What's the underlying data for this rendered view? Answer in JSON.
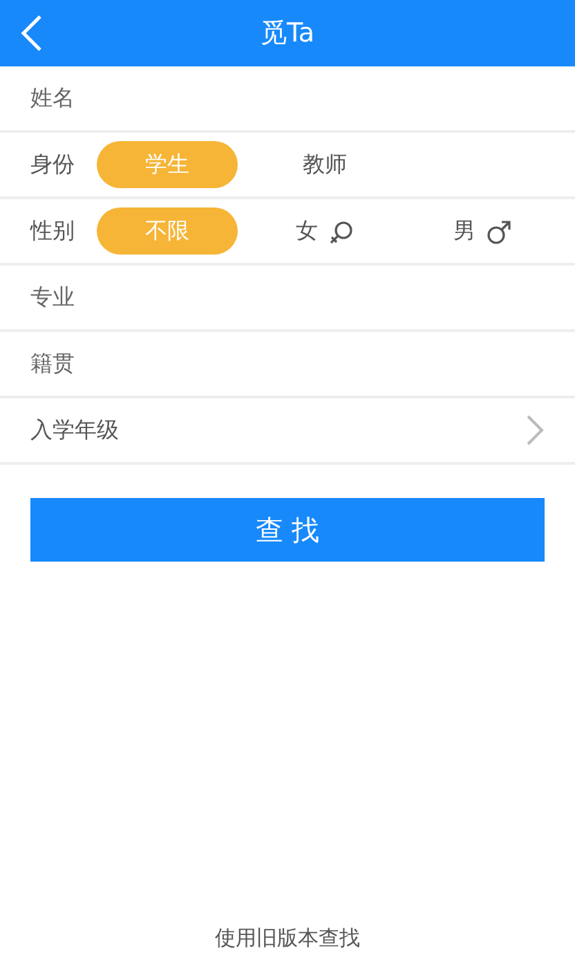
{
  "header": {
    "title": "觅Ta"
  },
  "name_field": {
    "placeholder": "姓名"
  },
  "choice_rows": [
    {
      "label": "身份",
      "options": [
        {
          "label": "学生",
          "selected": true
        },
        {
          "label": "教师",
          "selected": false
        }
      ]
    },
    {
      "label": "性别",
      "options": [
        {
          "label": "不限",
          "selected": true
        },
        {
          "label": "女",
          "kind": "female",
          "selected": false
        },
        {
          "label": "男",
          "kind": "male",
          "selected": false
        }
      ]
    }
  ],
  "text_fields": [
    {
      "placeholder": "专业"
    },
    {
      "placeholder": "籍贯"
    }
  ],
  "select_row": {
    "label": "入学年级"
  },
  "search_button": "查 找",
  "footer_link": "使用旧版本查找"
}
